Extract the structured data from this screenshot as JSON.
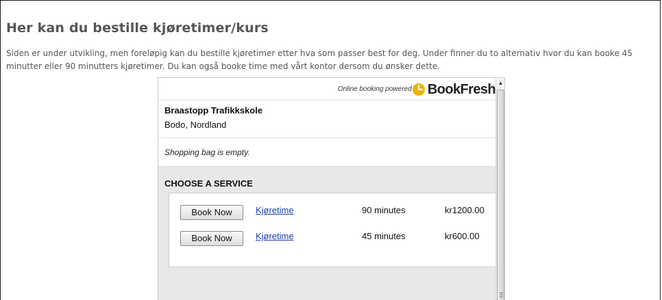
{
  "page": {
    "title": "Her kan du bestille kjøretimer/kurs",
    "intro": "Siden er under utvikling, men foreløpig kan du bestille kjøretimer etter hva som passer best for deg. Under finner du to alternativ hvor du kan booke 45 minutter eller 90 minutters kjøretimer. Du kan også booke time med vårt kontor dersom du ønsker dette."
  },
  "widget": {
    "powered_by": "Online booking powered by",
    "logo_text": "BookFresh",
    "logo_icon": "clock-icon",
    "business_name": "Braastopp Trafikkskole",
    "business_location": "Bodo, Nordland",
    "bag_status": "Shopping bag is empty.",
    "choose_heading": "CHOOSE A SERVICE",
    "services": [
      {
        "button": "Book Now",
        "name": "Kjøretime",
        "duration": "90 minutes",
        "price": "kr1200.00"
      },
      {
        "button": "Book Now",
        "name": "Kjøretime",
        "duration": "45 minutes",
        "price": "kr600.00"
      }
    ]
  },
  "colors": {
    "heading": "#555555",
    "link": "#1a3fb3",
    "logo_accent": "#f2b100",
    "panel_bg": "#e8e8e8"
  }
}
